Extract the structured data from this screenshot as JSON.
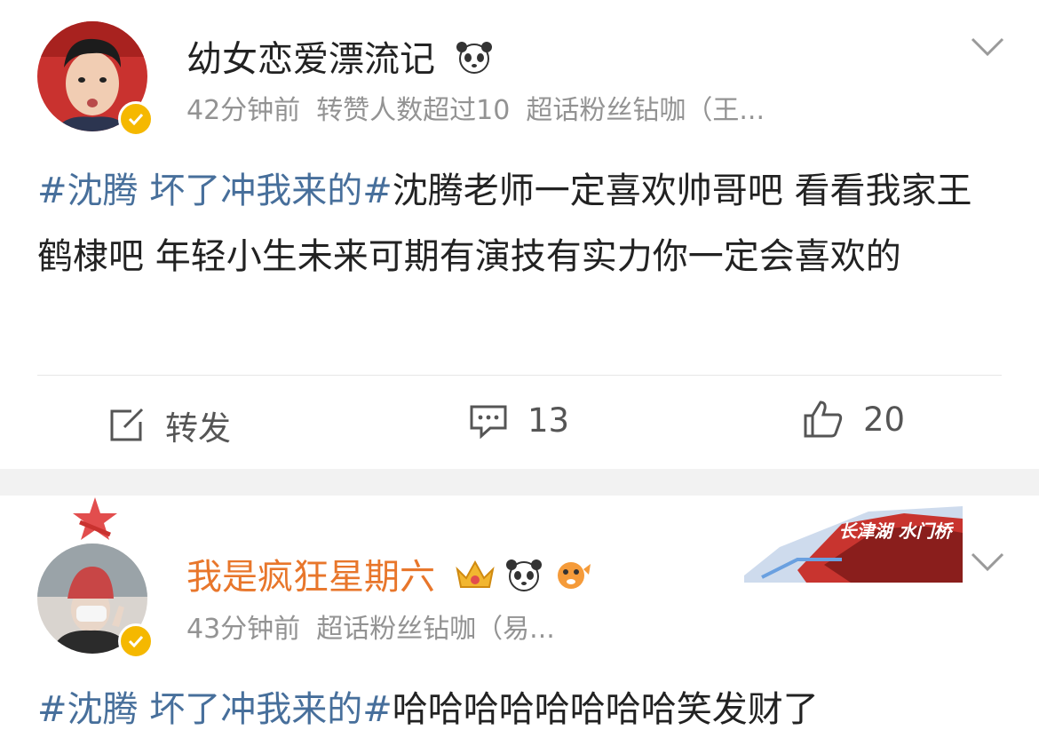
{
  "posts": [
    {
      "username": "幼女恋爱漂流记",
      "time": "42分钟前",
      "repost_note": "转赞人数超过10",
      "badge": "超话粉丝钻咖（王...",
      "tag": "#沈腾 坏了冲我来的#",
      "text": "沈腾老师一定喜欢帅哥吧 看看我家王鹤棣吧 年轻小生未来可期有演技有实力你一定会喜欢的",
      "actions": {
        "repost": "转发",
        "comments": "13",
        "likes": "20"
      }
    },
    {
      "username": "我是疯狂星期六",
      "time": "43分钟前",
      "badge": "超话粉丝钻咖（易...",
      "tag": "#沈腾 坏了冲我来的#",
      "text": "哈哈哈哈哈哈哈哈笑发财了",
      "banner_text": "长津湖 水门桥"
    }
  ],
  "colors": {
    "username2": "#e8762b",
    "tag": "#476f9b",
    "meta": "#939393",
    "verified": "#f5b800"
  }
}
